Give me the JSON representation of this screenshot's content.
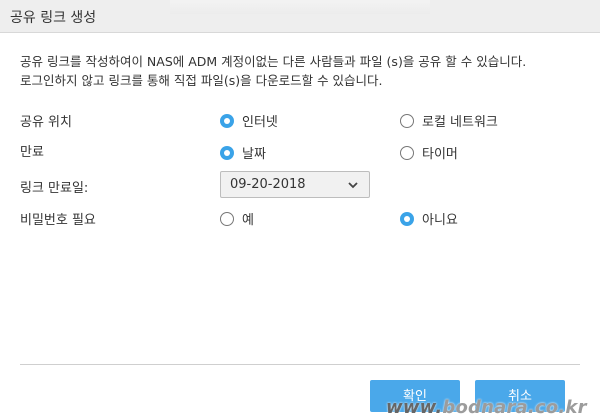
{
  "dialog": {
    "title": "공유 링크 생성",
    "description_line1": "공유 링크를 작성하여이 NAS에 ADM 계정이없는 다른 사람들과 파일 (s)을 공유 할 수 있습니다.",
    "description_line2": "로그인하지 않고 링크를 통해 직접 파일(s)을 다운로드할 수 있습니다."
  },
  "form": {
    "share_location": {
      "label": "공유 위치",
      "options": [
        {
          "label": "인터넷",
          "selected": true
        },
        {
          "label": "로컬 네트워크",
          "selected": false
        }
      ]
    },
    "expiry": {
      "label": "만료",
      "options": [
        {
          "label": "날짜",
          "selected": true
        },
        {
          "label": "타이머",
          "selected": false
        }
      ]
    },
    "expiry_date": {
      "label": "링크 만료일:",
      "value": "09-20-2018",
      "icon": "chevron-down-icon"
    },
    "password_required": {
      "label": "비밀번호 필요",
      "options": [
        {
          "label": "예",
          "selected": false
        },
        {
          "label": "아니요",
          "selected": true
        }
      ]
    }
  },
  "buttons": {
    "ok_label": "확인",
    "cancel_label": "취소"
  },
  "watermark": {
    "prefix": "www.",
    "text": "bodnara.co.kr"
  },
  "colors": {
    "accent": "#3aa3e8",
    "button": "#4aa8ea",
    "titlebar": "#eeeeee"
  }
}
